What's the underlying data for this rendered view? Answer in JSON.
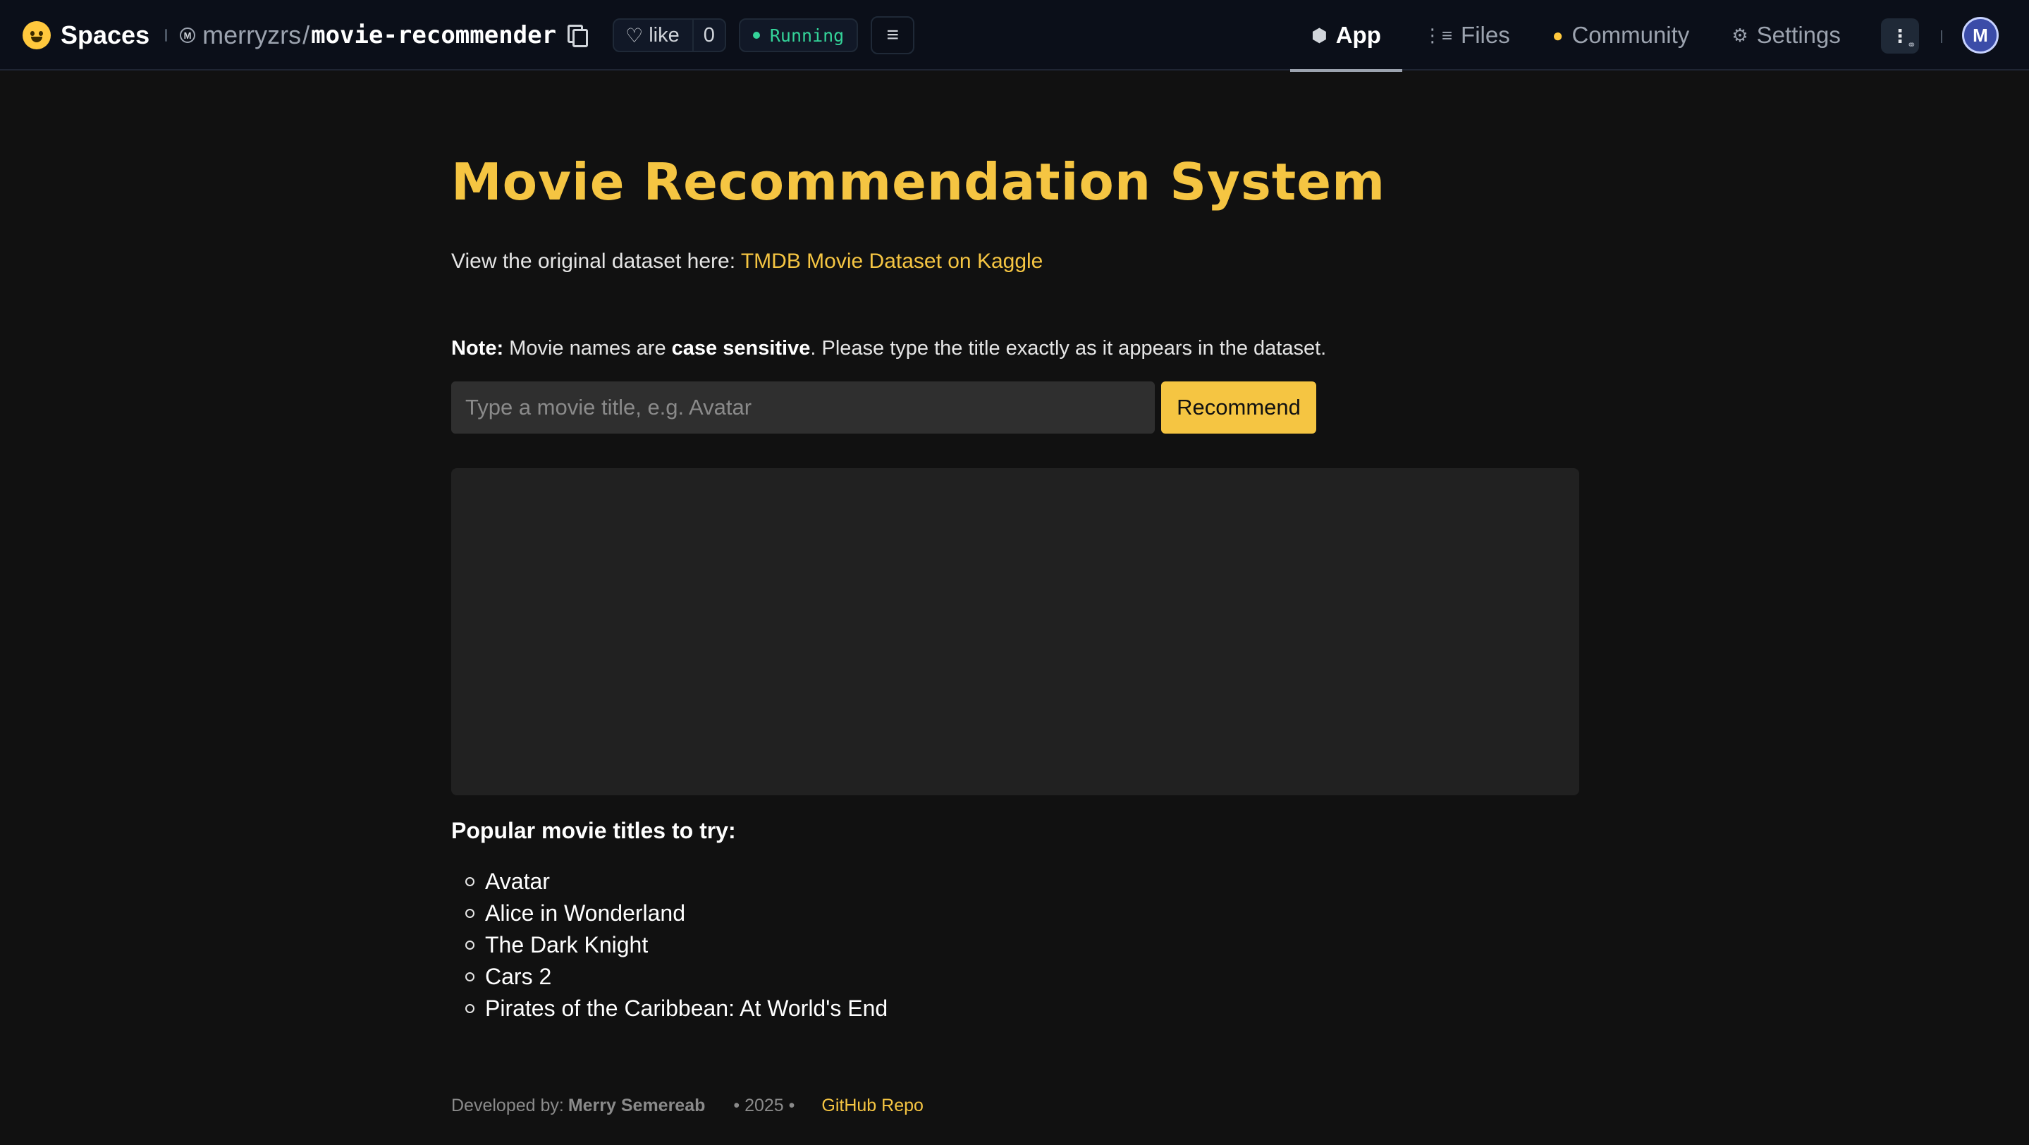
{
  "header": {
    "brand": "Spaces",
    "owner": "merryzrs",
    "separator": "/",
    "repo": "movie-recommender",
    "like_label": "like",
    "like_count": "0",
    "status": "Running",
    "user_initial": "M",
    "tabs": [
      {
        "label": "App",
        "icon": "cube-icon",
        "active": true
      },
      {
        "label": "Files",
        "icon": "files-icon",
        "active": false
      },
      {
        "label": "Community",
        "icon": "community-icon",
        "active": false
      },
      {
        "label": "Settings",
        "icon": "gear-icon",
        "active": false
      }
    ]
  },
  "main": {
    "title": "Movie Recommendation System",
    "dataset_prefix": "View the original dataset here: ",
    "dataset_link": "TMDB Movie Dataset on Kaggle",
    "note_label": "Note:",
    "note_mid": " Movie names are ",
    "note_bold": "case sensitive",
    "note_end": ". Please type the title exactly as it appears in the dataset.",
    "search_placeholder": "Type a movie title, e.g. Avatar",
    "search_value": "",
    "recommend_label": "Recommend",
    "popular_heading": "Popular movie titles to try:",
    "popular_titles": [
      "Avatar",
      "Alice in Wonderland",
      "The Dark Knight",
      "Cars 2",
      "Pirates of the Caribbean: At World's End"
    ]
  },
  "footer": {
    "developed_by": "Developed by:",
    "developer": "Merry Semereab",
    "year": "• 2025 •",
    "repo_link": "GitHub Repo"
  },
  "colors": {
    "accent": "#f5c542",
    "background": "#111111",
    "panel": "#212121",
    "status_green": "#34d399"
  }
}
